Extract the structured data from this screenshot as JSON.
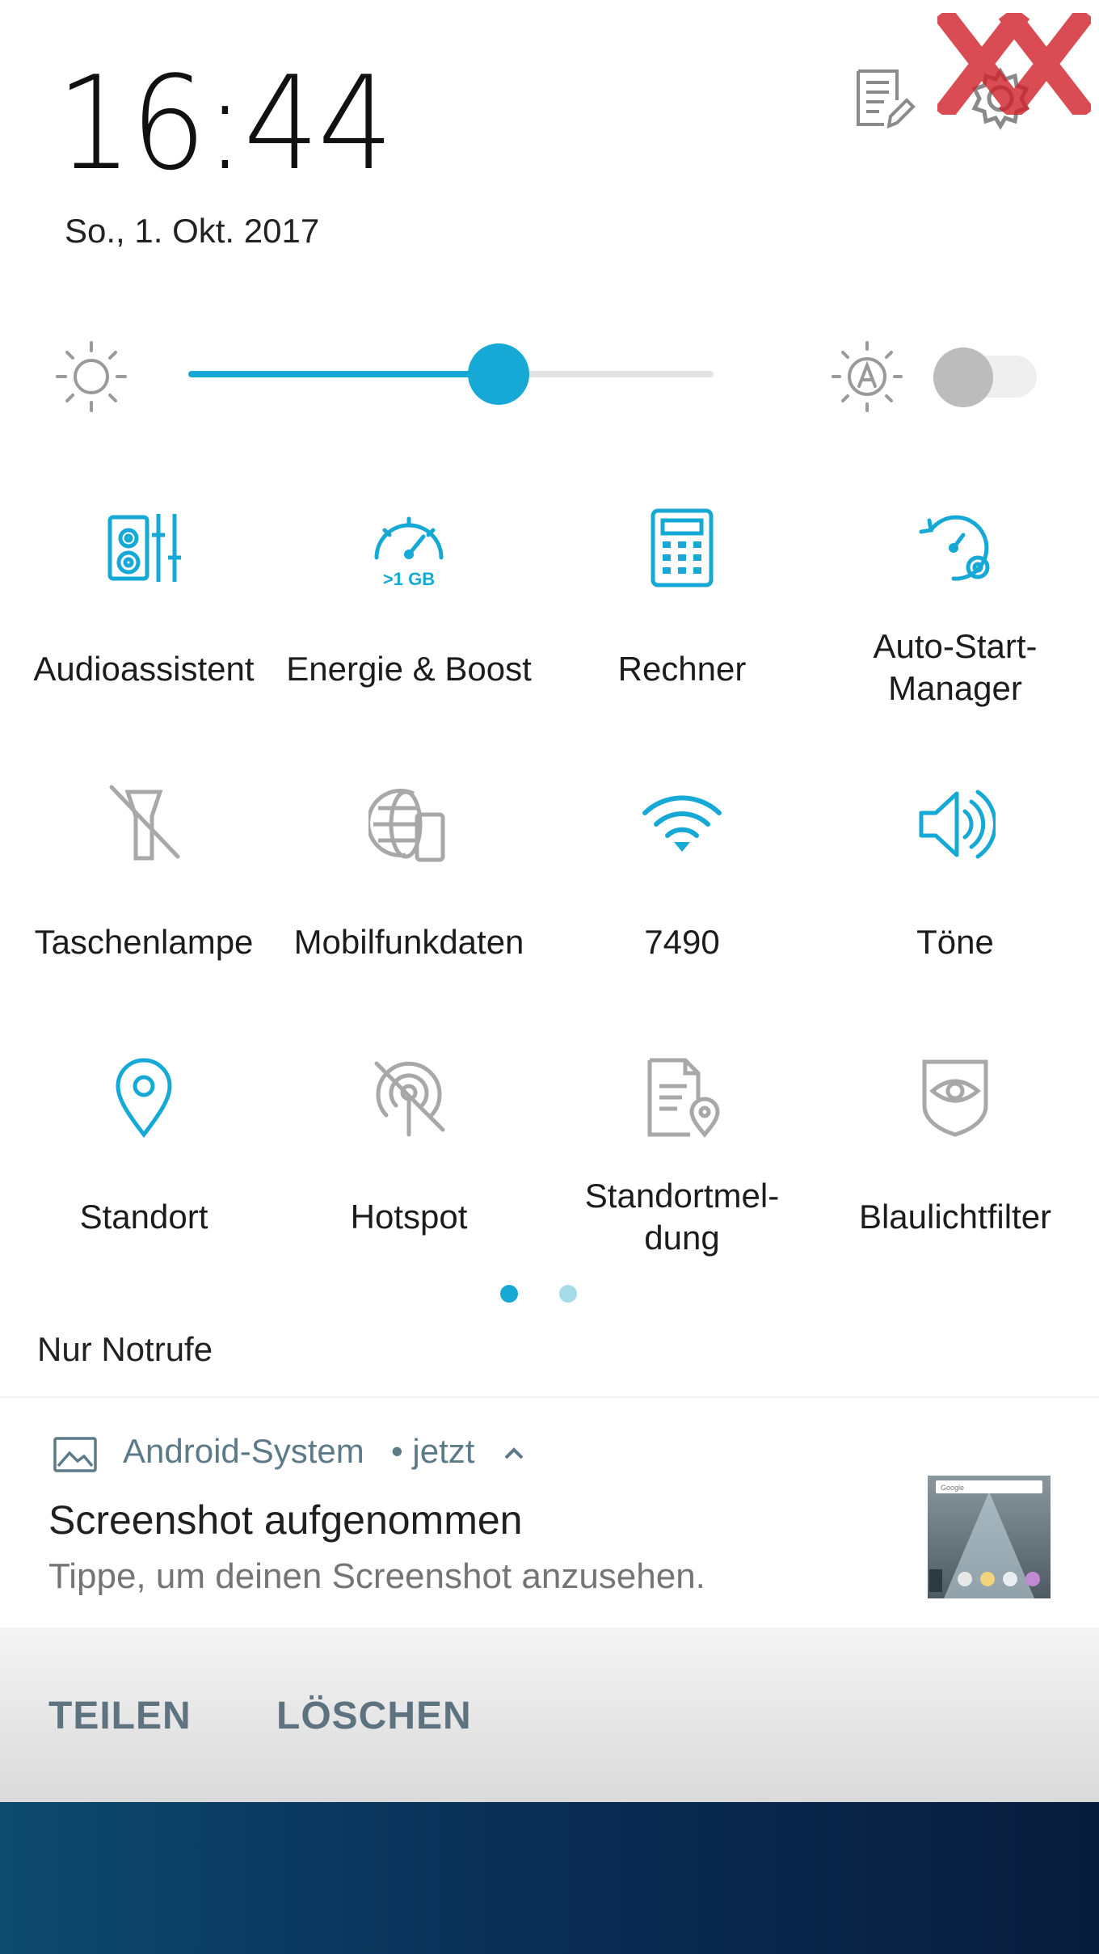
{
  "status": {
    "clock": "16:44",
    "date": "So., 1. Okt. 2017"
  },
  "header_icons": [
    "edit-notes-icon",
    "settings-gear-icon"
  ],
  "brightness": {
    "level": 0.59,
    "auto_enabled": false,
    "icons": [
      "brightness-sun-icon",
      "auto-brightness-icon"
    ]
  },
  "tiles": [
    {
      "label": "Audioassistent",
      "icon": "audio-assistant-icon",
      "active": true
    },
    {
      "label": "Energie & Boost",
      "icon": "speedometer-boost-icon",
      "active": true,
      "icon_text": ">1 GB"
    },
    {
      "label": "Rechner",
      "icon": "calculator-icon",
      "active": true
    },
    {
      "label": "Auto-Start-\nManager",
      "icon": "auto-start-manager-icon",
      "active": true
    },
    {
      "label": "Taschenlampe",
      "icon": "flashlight-off-icon",
      "active": false
    },
    {
      "label": "Mobilfunkdaten",
      "icon": "mobile-data-icon",
      "active": false
    },
    {
      "label": "7490",
      "icon": "wifi-icon",
      "active": true
    },
    {
      "label": "Töne",
      "icon": "volume-icon",
      "active": true
    },
    {
      "label": "Standort",
      "icon": "location-pin-icon",
      "active": true
    },
    {
      "label": "Hotspot",
      "icon": "hotspot-off-icon",
      "active": false
    },
    {
      "label": "Standortmel-\ndung",
      "icon": "location-report-icon",
      "active": false
    },
    {
      "label": "Blaulichtfilter",
      "icon": "blue-light-filter-icon",
      "active": false
    }
  ],
  "pager": {
    "pages": 2,
    "current": 1
  },
  "emergency_text": "Nur Notrufe",
  "notification": {
    "app": "Android-System",
    "meta": "• jetzt",
    "title": "Screenshot aufgenommen",
    "text": "Tippe, um deinen Screenshot anzusehen.",
    "thumb_search": "Google"
  },
  "actions": {
    "share": "TEILEN",
    "delete": "LÖSCHEN"
  },
  "colors": {
    "accent": "#17a9d5",
    "inactive": "#a8a8a8",
    "action_text": "#5e7380",
    "watermark": "#d0202a"
  }
}
